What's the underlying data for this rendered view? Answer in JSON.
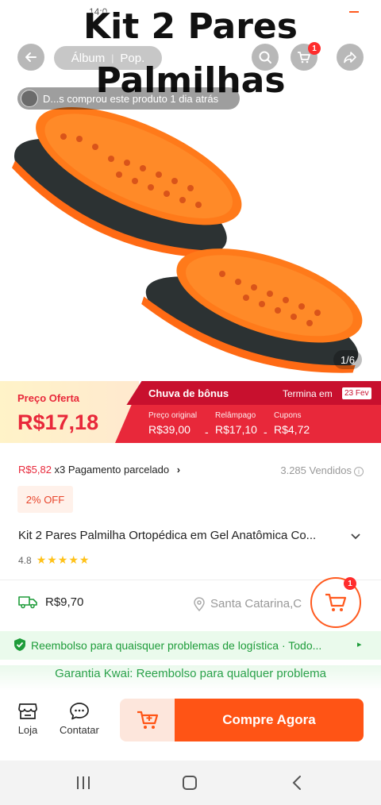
{
  "overlay": {
    "title_line1": "Kit 2 Pares",
    "title_line2": "Palmilhas",
    "status_text": "14:0"
  },
  "top_nav": {
    "segments": [
      "Álbum",
      "Pop."
    ],
    "cart_badge": "1"
  },
  "buyer_note": "D...s comprou este produto 1 dia atrás",
  "image_counter": "1/6",
  "price": {
    "offer_label": "Preço Oferta",
    "offer_price": "R$17,18",
    "bonus_title": "Chuva de bônus",
    "ends_label": "Termina em",
    "ends_date": "23 Fev",
    "breakdown": [
      {
        "label": "Preço original",
        "value": "R$39,00"
      },
      {
        "label": "Relâmpago",
        "value": "R$17,10"
      },
      {
        "label": "Cupons",
        "value": "R$4,72"
      }
    ],
    "minus": "-"
  },
  "installment": {
    "amount": "R$5,82",
    "text": " x3 Pagamento parcelado",
    "chevron": "›"
  },
  "sold": "3.285 Vendidos",
  "sold_info_icon": "i",
  "discount": "2% OFF",
  "product_title": "Kit 2 Pares Palmilha Ortopédica em Gel Anatômica Co...",
  "rating": {
    "value": "4.8",
    "stars": 5,
    "stars_text": "★★★★★"
  },
  "shipping": {
    "price": "R$9,70",
    "location": "Santa Catarina,C"
  },
  "float_cart_badge": "1",
  "refund_text": "Reembolso para quaisquer problemas de logística · Todo...",
  "refund_arrow": "▸",
  "guarantee_text": "Garantia Kwai: Reembolso para qualquer problema",
  "bottom_bar": {
    "store_label": "Loja",
    "contact_label": "Contatar",
    "buy_label": "Compre Agora"
  },
  "colors": {
    "accent": "#ff5415",
    "price_red": "#e8283a",
    "green": "#1e9c3a"
  }
}
